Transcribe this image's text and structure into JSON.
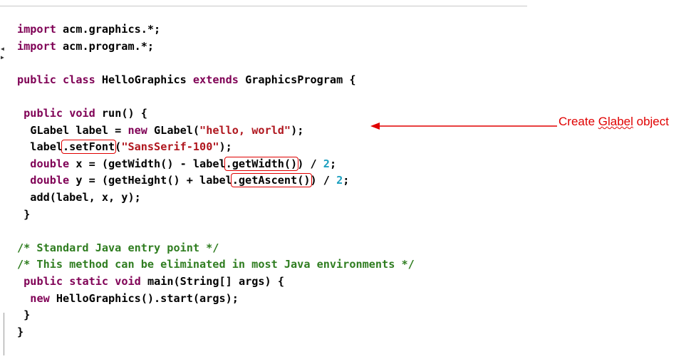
{
  "code_lines": [
    {
      "indent": "",
      "parts": [
        {
          "t": "import",
          "c": "kw"
        },
        {
          "t": " acm.graphics.*;"
        }
      ]
    },
    {
      "indent": "",
      "parts": [
        {
          "t": "import",
          "c": "kw"
        },
        {
          "t": " acm.program.*;"
        }
      ]
    },
    {
      "indent": "",
      "parts": []
    },
    {
      "indent": "",
      "parts": [
        {
          "t": "public",
          "c": "kw"
        },
        {
          "t": " "
        },
        {
          "t": "class",
          "c": "kw"
        },
        {
          "t": " HelloGraphics "
        },
        {
          "t": "extends",
          "c": "kw"
        },
        {
          "t": " GraphicsProgram {"
        }
      ]
    },
    {
      "indent": "",
      "parts": []
    },
    {
      "indent": " ",
      "parts": [
        {
          "t": "public",
          "c": "kw"
        },
        {
          "t": " "
        },
        {
          "t": "void",
          "c": "kw"
        },
        {
          "t": " run() {"
        }
      ]
    },
    {
      "indent": "  ",
      "parts": [
        {
          "t": "GLabel label = "
        },
        {
          "t": "new",
          "c": "kw"
        },
        {
          "t": " GLabel("
        },
        {
          "t": "\"hello, world\"",
          "c": "str"
        },
        {
          "t": ");"
        }
      ]
    },
    {
      "indent": "  ",
      "parts": [
        {
          "t": "label"
        },
        {
          "t": ".setFont",
          "box": true
        },
        {
          "t": "("
        },
        {
          "t": "\"SansSerif-100\"",
          "c": "str"
        },
        {
          "t": ");"
        }
      ]
    },
    {
      "indent": "  ",
      "parts": [
        {
          "t": "double",
          "c": "kw"
        },
        {
          "t": " x = (getWidth() - label"
        },
        {
          "t": ".getWidth()",
          "box": true
        },
        {
          "t": ") / "
        },
        {
          "t": "2",
          "c": "num"
        },
        {
          "t": ";"
        }
      ]
    },
    {
      "indent": "  ",
      "parts": [
        {
          "t": "double",
          "c": "kw"
        },
        {
          "t": " y = (getHeight() + label"
        },
        {
          "t": ".getAscent()",
          "box": true
        },
        {
          "t": ") / "
        },
        {
          "t": "2",
          "c": "num"
        },
        {
          "t": ";"
        }
      ]
    },
    {
      "indent": "  ",
      "parts": [
        {
          "t": "add(label, x, y);"
        }
      ]
    },
    {
      "indent": " ",
      "parts": [
        {
          "t": "}"
        }
      ]
    },
    {
      "indent": "",
      "parts": []
    },
    {
      "indent": "",
      "parts": [
        {
          "t": "/* Standard Java entry point */",
          "c": "cmt"
        }
      ]
    },
    {
      "indent": "",
      "parts": [
        {
          "t": "/* This method can be eliminated in most Java environments */",
          "c": "cmt"
        }
      ]
    },
    {
      "indent": " ",
      "parts": [
        {
          "t": "public",
          "c": "kw"
        },
        {
          "t": " "
        },
        {
          "t": "static",
          "c": "kw"
        },
        {
          "t": " "
        },
        {
          "t": "void",
          "c": "kw"
        },
        {
          "t": " main(String[] args) {"
        }
      ]
    },
    {
      "indent": "  ",
      "parts": [
        {
          "t": "new",
          "c": "kw"
        },
        {
          "t": " HelloGraphics().start(args);"
        }
      ]
    },
    {
      "indent": " ",
      "parts": [
        {
          "t": "}"
        }
      ]
    },
    {
      "indent": "",
      "parts": [
        {
          "t": "}"
        }
      ]
    }
  ],
  "annotation": {
    "prefix": "Create ",
    "word": "Glabel",
    "suffix": " object"
  },
  "colors": {
    "keyword": "#7f0055",
    "string": "#b0171f",
    "number": "#1c9fbf",
    "comment": "#2f7d20",
    "highlight_box": "#e00000"
  }
}
